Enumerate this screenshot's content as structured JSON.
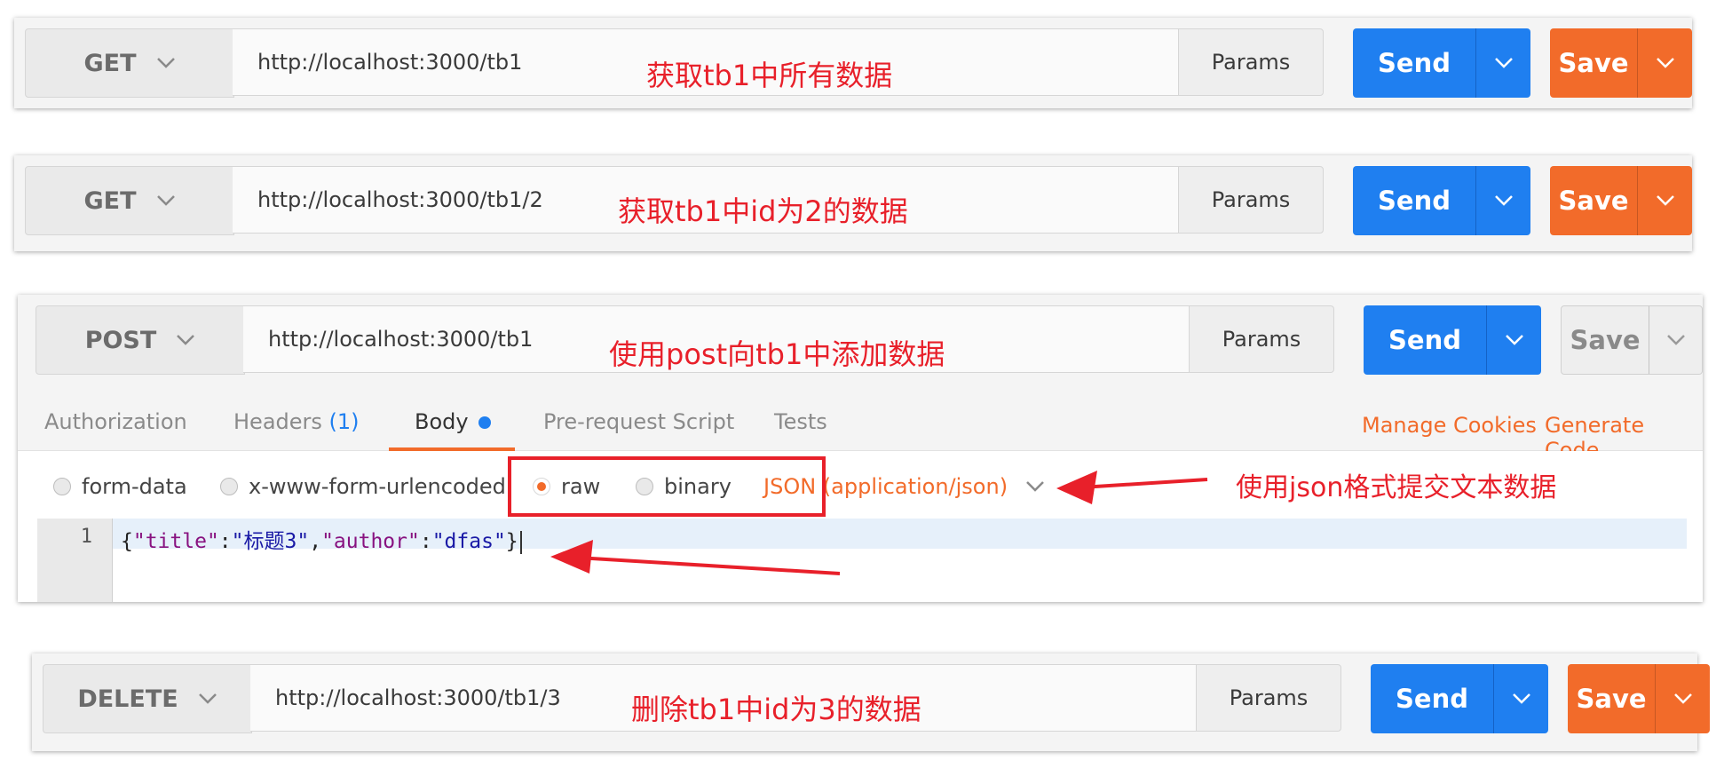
{
  "requests": [
    {
      "method": "GET",
      "url": "http://localhost:3000/tb1",
      "params_label": "Params",
      "send_label": "Send",
      "save_label": "Save",
      "annotation": "获取tb1中所有数据"
    },
    {
      "method": "GET",
      "url": "http://localhost:3000/tb1/2",
      "params_label": "Params",
      "send_label": "Send",
      "save_label": "Save",
      "annotation": "获取tb1中id为2的数据"
    },
    {
      "method": "POST",
      "url": "http://localhost:3000/tb1",
      "params_label": "Params",
      "send_label": "Send",
      "save_label": "Save",
      "annotation": "使用post向tb1中添加数据",
      "tabs": {
        "authorization": "Authorization",
        "headers": "Headers",
        "headers_count": "(1)",
        "body": "Body",
        "prerequest": "Pre-request Script",
        "tests": "Tests",
        "active": "Body"
      },
      "links": {
        "manage_cookies": "Manage Cookies",
        "generate_code": "Generate Code"
      },
      "body_modes": {
        "form_data": "form-data",
        "urlencoded": "x-www-form-urlencoded",
        "raw": "raw",
        "binary": "binary",
        "selected": "raw",
        "content_type": "JSON (application/json)"
      },
      "body_annotation": "使用json格式提交文本数据",
      "editor": {
        "line_number": "1",
        "tokens": [
          "{",
          "\"title\"",
          ":",
          "\"标题3\"",
          ",",
          "\"author\"",
          ":",
          "\"dfas\"",
          "}"
        ]
      }
    },
    {
      "method": "DELETE",
      "url": "http://localhost:3000/tb1/3",
      "params_label": "Params",
      "send_label": "Send",
      "save_label": "Save",
      "annotation": "删除tb1中id为3的数据"
    }
  ],
  "colors": {
    "send": "#1f7ff0",
    "save": "#f26b2a",
    "annotation": "#e8202a",
    "tab_active_underline": "#f26b2a"
  },
  "icons": {
    "dropdown": "chevron-down-icon",
    "annotation_arrow": "arrow-left-icon",
    "unsaved_indicator": "dot-icon"
  }
}
